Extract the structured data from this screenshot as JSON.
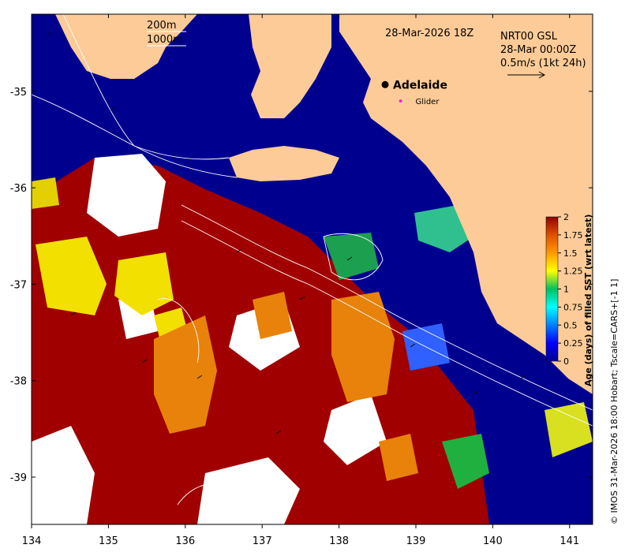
{
  "map": {
    "timestamp": "28-Mar-2026 18Z",
    "contours": {
      "line1": "200m",
      "line2": "1000m"
    },
    "current": {
      "product": "NRT00 GSL",
      "time": "28-Mar 00:00Z",
      "scale": "0.5m/s (1kt 24h)"
    },
    "places": [
      {
        "name": "Adelaide",
        "lon": 138.6,
        "lat": -34.93
      }
    ],
    "glider": {
      "label": "Glider",
      "lon": 138.8,
      "lat": -35.1
    },
    "extent": {
      "lon": [
        134,
        141.3
      ],
      "lat": [
        -39.5,
        -34.2
      ]
    },
    "x_ticks": [
      {
        "value": 134,
        "label": "134"
      },
      {
        "value": 135,
        "label": "135"
      },
      {
        "value": 136,
        "label": "136"
      },
      {
        "value": 137,
        "label": "137"
      },
      {
        "value": 138,
        "label": "138"
      },
      {
        "value": 139,
        "label": "139"
      },
      {
        "value": 140,
        "label": "140"
      },
      {
        "value": 141,
        "label": "141"
      }
    ],
    "y_ticks": [
      {
        "value": -35,
        "label": "-35"
      },
      {
        "value": -36,
        "label": "-36"
      },
      {
        "value": -37,
        "label": "-37"
      },
      {
        "value": -38,
        "label": "-38"
      },
      {
        "value": -39,
        "label": "-39"
      }
    ],
    "colors": {
      "land": "#fdcb97",
      "ocean_fresh": "#00008f",
      "missing": "#ffffff",
      "old": "#8f0000"
    }
  },
  "colorbar": {
    "label": "Age (days) of filled SST (wrt latest)",
    "range": [
      0,
      2
    ],
    "ticks": [
      {
        "value": 0,
        "label": "0"
      },
      {
        "value": 0.25,
        "label": "0.25"
      },
      {
        "value": 0.5,
        "label": "0.5"
      },
      {
        "value": 0.75,
        "label": "0.75"
      },
      {
        "value": 1,
        "label": "1"
      },
      {
        "value": 1.25,
        "label": "1.25"
      },
      {
        "value": 1.5,
        "label": "1.5"
      },
      {
        "value": 1.75,
        "label": "1.75"
      },
      {
        "value": 2,
        "label": "2"
      }
    ]
  },
  "credit": "© IMOS 31-Mar-2026 18:00 Hobart; Tscale=CARS+[-1 1]"
}
